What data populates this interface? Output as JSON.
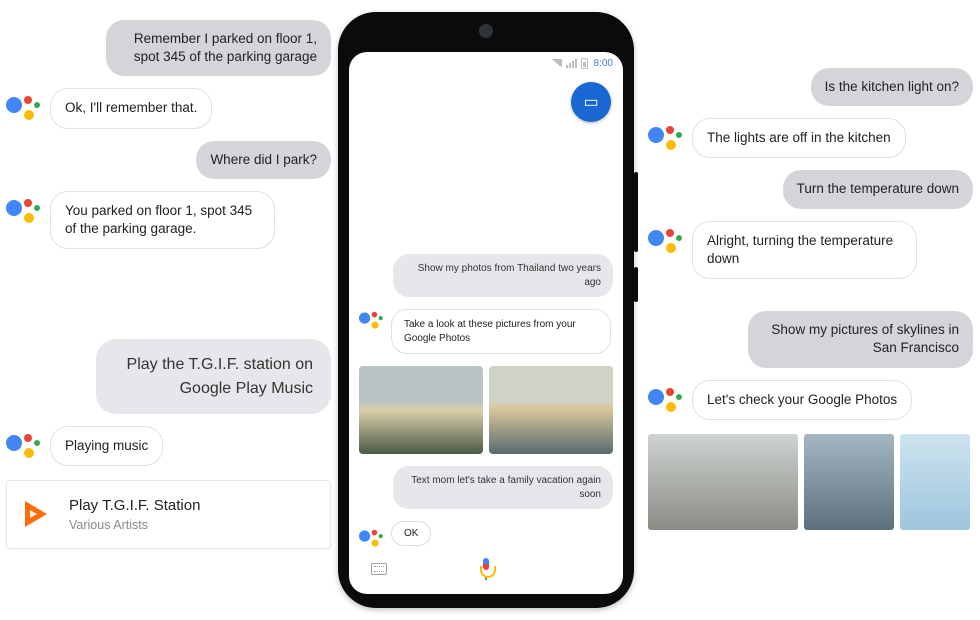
{
  "left": {
    "u1": "Remember I parked on floor 1, spot 345 of the parking garage",
    "a1": "Ok, I'll remember that.",
    "u2": "Where did I park?",
    "a2": "You parked on floor 1, spot 345 of the parking garage.",
    "u3": "Play the T.G.I.F. station on Google Play Music",
    "a3": "Playing music",
    "music_title": "Play T.G.I.F. Station",
    "music_artist": "Various Artists"
  },
  "right": {
    "u1": "Is the kitchen light on?",
    "a1": "The lights are off in the kitchen",
    "u2": "Turn the temperature down",
    "a2": "Alright, turning the temperature down",
    "u3": "Show my pictures of skylines in San Francisco",
    "a3": "Let's check your Google Photos"
  },
  "phone": {
    "clock": "8:00",
    "u1": "Show my photos from Thailand two years ago",
    "a1": "Take a look at these pictures from your Google Photos",
    "u2": "Text mom let's take a family vacation again soon",
    "a2": "OK"
  }
}
